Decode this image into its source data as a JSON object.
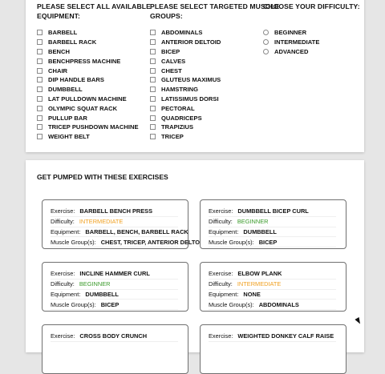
{
  "colors": {
    "beginner": "#3a9a2a",
    "intermediate": "#f0a020"
  },
  "equipment": {
    "heading_line1": "PLEASE SELECT ALL AVAILABLE",
    "heading_line2": "EQUIPMENT:",
    "items": [
      "BARBELL",
      "BARBELL RACK",
      "BENCH",
      "BENCHPRESS MACHINE",
      "CHAIR",
      "DIP HANDLE BARS",
      "DUMBBELL",
      "LAT PULLDOWN MACHINE",
      "OLYMPIC SQUAT RACK",
      "PULLUP BAR",
      "TRICEP PUSHDOWN MACHINE",
      "WEIGHT BELT"
    ]
  },
  "muscles": {
    "heading_line1": "PLEASE SELECT TARGETED MUSCLE",
    "heading_line2": "GROUPS:",
    "items": [
      "ABDOMINALS",
      "ANTERIOR DELTOID",
      "BICEP",
      "CALVES",
      "CHEST",
      "GLUTEUS MAXIMUS",
      "HAMSTRING",
      "LATISSIMUS DORSI",
      "PECTORAL",
      "QUADRICEPS",
      "TRAPIZIUS",
      "TRICEP"
    ]
  },
  "difficulty": {
    "heading": "CHOOSE YOUR DIFFICULTY:",
    "items": [
      "BEGINNER",
      "INTERMEDIATE",
      "ADVANCED"
    ]
  },
  "results": {
    "heading": "GET PUMPED WITH THESE EXERCISES",
    "labels": {
      "exercise": "Exercise:",
      "difficulty": "Difficulty:",
      "equipment": "Equipment:",
      "muscle": "Muscle Group(s):"
    },
    "cards": [
      {
        "exercise": "BARBELL BENCH PRESS",
        "difficulty": "INTERMEDIATE",
        "equipment": "BARBELL, BENCH, BARBELL RACK",
        "muscle": "CHEST, TRICEP, ANTERIOR DELTOID"
      },
      {
        "exercise": "DUMBBELL BICEP CURL",
        "difficulty": "BEGINNER",
        "equipment": "DUMBBELL",
        "muscle": "BICEP"
      },
      {
        "exercise": "INCLINE HAMMER CURL",
        "difficulty": "BEGINNER",
        "equipment": "DUMBBELL",
        "muscle": "BICEP"
      },
      {
        "exercise": "ELBOW PLANK",
        "difficulty": "INTERMEDIATE",
        "equipment": "NONE",
        "muscle": "ABDOMINALS"
      },
      {
        "exercise": "CROSS BODY CRUNCH"
      },
      {
        "exercise": "WEIGHTED DONKEY CALF RAISE"
      }
    ]
  }
}
